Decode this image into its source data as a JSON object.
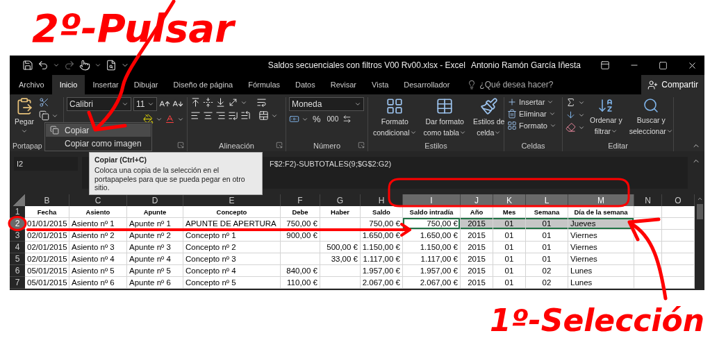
{
  "annotations": {
    "top": "2º-Pulsar",
    "bottom": "1º-Selección"
  },
  "window": {
    "title": "Saldos secuenciales con filtros V00 Rv00.xlsx - Excel",
    "user": "Antonio Ramón García Iñesta"
  },
  "tabs": [
    {
      "label": "Archivo",
      "selected": false
    },
    {
      "label": "Inicio",
      "selected": true
    },
    {
      "label": "Insertar",
      "selected": false
    },
    {
      "label": "Dibujar",
      "selected": false
    },
    {
      "label": "Diseño de página",
      "selected": false
    },
    {
      "label": "Fórmulas",
      "selected": false
    },
    {
      "label": "Datos",
      "selected": false
    },
    {
      "label": "Revisar",
      "selected": false
    },
    {
      "label": "Vista",
      "selected": false
    },
    {
      "label": "Desarrollador",
      "selected": false
    }
  ],
  "search": {
    "placeholder": "¿Qué desea hacer?"
  },
  "share": "Compartir",
  "ribbon": {
    "clipboard": {
      "paste": "Pegar",
      "label": "Portapap"
    },
    "font": {
      "name": "Calibri",
      "size": "11"
    },
    "alignment": {
      "label": "Alineación"
    },
    "number": {
      "format": "Moneda",
      "percent": "%",
      "thousands": "000",
      "label": "Número"
    },
    "styles": {
      "label": "Estilos",
      "buttons": [
        {
          "lines": [
            "Formato",
            "condicional"
          ]
        },
        {
          "lines": [
            "Dar formato",
            "como tabla"
          ]
        },
        {
          "lines": [
            "Estilos de",
            "celda"
          ]
        }
      ]
    },
    "cells": {
      "label": "Celdas",
      "buttons": [
        "Insertar",
        "Eliminar",
        "Formato"
      ]
    },
    "edit": {
      "label": "Editar",
      "buttons": [
        {
          "lines": [
            "Ordenar y",
            "filtrar"
          ]
        },
        {
          "lines": [
            "Buscar y",
            "seleccionar"
          ]
        }
      ]
    }
  },
  "menu": [
    {
      "label": "Copiar",
      "selected": true
    },
    {
      "label": "Copiar como imagen",
      "selected": false
    }
  ],
  "tooltip": {
    "title": "Copiar (Ctrl+C)",
    "body": "Coloca una copia de la selección en el portapapeles para que se pueda pegar en otro sitio."
  },
  "formula_bar": {
    "name_box": "I2",
    "formula": "F$2:F2)-SUBTOTALES(9;$G$2:G2)"
  },
  "sheet": {
    "columns": [
      {
        "label": "B",
        "kind": "text",
        "selected": false
      },
      {
        "label": "C",
        "kind": "text",
        "selected": false
      },
      {
        "label": "D",
        "kind": "text",
        "selected": false
      },
      {
        "label": "E",
        "kind": "text",
        "selected": false
      },
      {
        "label": "F",
        "kind": "amount",
        "selected": false
      },
      {
        "label": "G",
        "kind": "amount",
        "selected": false
      },
      {
        "label": "H",
        "kind": "amount",
        "selected": false
      },
      {
        "label": "I",
        "kind": "amount",
        "selected": true
      },
      {
        "label": "J",
        "kind": "code",
        "selected": true
      },
      {
        "label": "K",
        "kind": "code",
        "selected": true
      },
      {
        "label": "L",
        "kind": "code",
        "selected": true
      },
      {
        "label": "M",
        "kind": "text",
        "selected": true
      },
      {
        "label": "N",
        "kind": "text",
        "selected": false
      },
      {
        "label": "O",
        "kind": "text",
        "selected": false
      }
    ],
    "rows": [
      {
        "number": "1",
        "kind": "header",
        "selected": false,
        "cells": [
          "Fecha",
          "Asiento",
          "Apunte",
          "Concepto",
          "Debe",
          "Haber",
          "Saldo",
          "Saldo intradía",
          "Año",
          "Mes",
          "Semana",
          "Día de la semana"
        ]
      },
      {
        "number": "2",
        "kind": "data",
        "selected": true,
        "cells": [
          "01/01/2015",
          "Asiento nº 1",
          "Apunte nº 1",
          "APUNTE DE APERTURA",
          "750,00 €",
          null,
          "750,00 €",
          "750,00 €",
          "2015",
          "01",
          "01",
          "Jueves"
        ]
      },
      {
        "number": "3",
        "kind": "data",
        "selected": false,
        "cells": [
          "02/01/2015",
          "Asiento nº 2",
          "Apunte nº 2",
          "Concepto nº 1",
          "900,00 €",
          null,
          "1.650,00 €",
          "1.650,00 €",
          "2015",
          "01",
          "01",
          "Viernes"
        ]
      },
      {
        "number": "4",
        "kind": "data",
        "selected": false,
        "cells": [
          "02/01/2015",
          "Asiento nº 3",
          "Apunte nº 3",
          "Concepto nº 2",
          null,
          "500,00 €",
          "1.150,00 €",
          "1.150,00 €",
          "2015",
          "01",
          "01",
          "Viernes"
        ]
      },
      {
        "number": "5",
        "kind": "data",
        "selected": false,
        "cells": [
          "02/01/2015",
          "Asiento nº 4",
          "Apunte nº 4",
          "Concepto nº 3",
          null,
          "33,00 €",
          "1.117,00 €",
          "1.117,00 €",
          "2015",
          "01",
          "01",
          "Viernes"
        ]
      },
      {
        "number": "6",
        "kind": "data",
        "selected": false,
        "cells": [
          "05/01/2015",
          "Asiento nº 5",
          "Apunte nº 5",
          "Concepto nº 4",
          "840,00 €",
          null,
          "1.957,00 €",
          "1.957,00 €",
          "2015",
          "01",
          "02",
          "Lunes"
        ]
      },
      {
        "number": "7",
        "kind": "data",
        "selected": false,
        "cells": [
          "05/01/2015",
          "Asiento nº 6",
          "Apunte nº 6",
          "Concepto nº 5",
          "110,00 €",
          null,
          "2.067,00 €",
          "2.067,00 €",
          "2015",
          "01",
          "02",
          "Lunes"
        ]
      }
    ]
  }
}
